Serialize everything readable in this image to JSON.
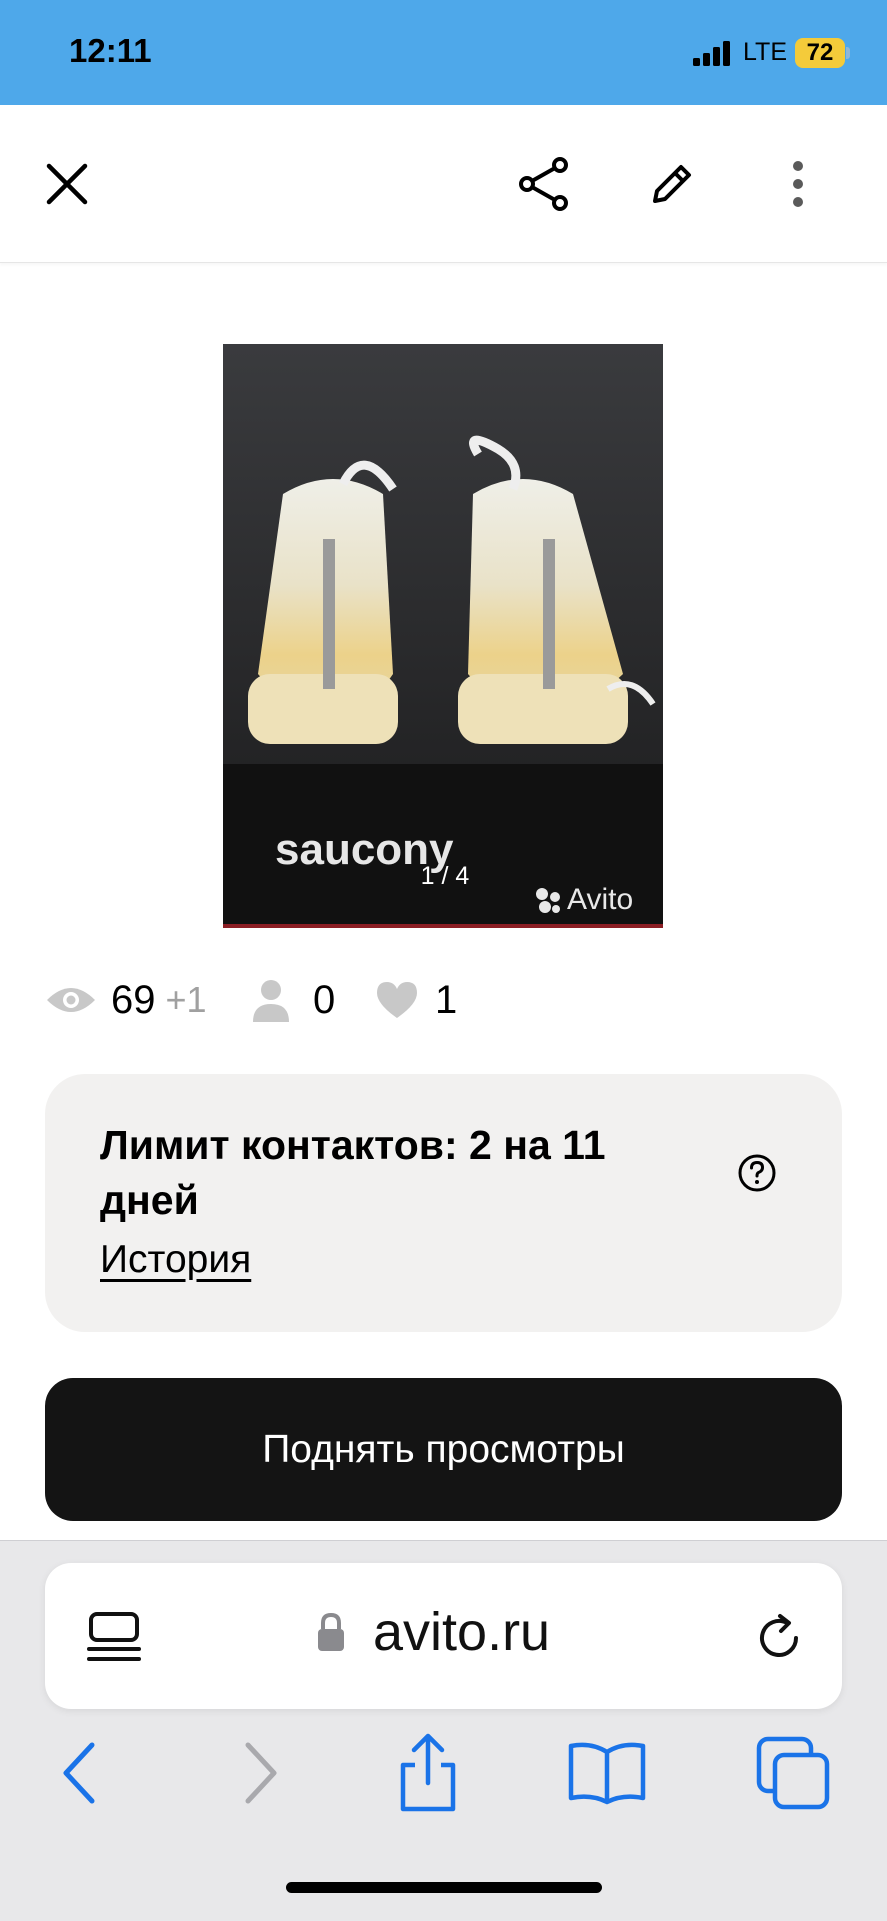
{
  "status_bar": {
    "time": "12:11",
    "network": "LTE",
    "battery": "72"
  },
  "top_nav": {
    "close_icon": "close-icon",
    "share_icon": "share-icon",
    "edit_icon": "pencil-icon",
    "more_icon": "more-vertical-icon"
  },
  "gallery": {
    "counter": "1 / 4",
    "brand_text": "saucony",
    "watermark": "Avito"
  },
  "stats": {
    "views": "69",
    "views_delta": "+1",
    "contacts": "0",
    "favorites": "1"
  },
  "limit_card": {
    "title": "Лимит контактов: 2 на 11 дней",
    "link": "История"
  },
  "promote_button": {
    "label": "Поднять просмотры"
  },
  "browser": {
    "url": "avito.ru"
  },
  "colors": {
    "status_bar": "#4ea8ea",
    "battery": "#f4cb3a",
    "ios_blue": "#1a73e8",
    "button_dark": "#141414",
    "card_bg": "#f2f1f0"
  }
}
